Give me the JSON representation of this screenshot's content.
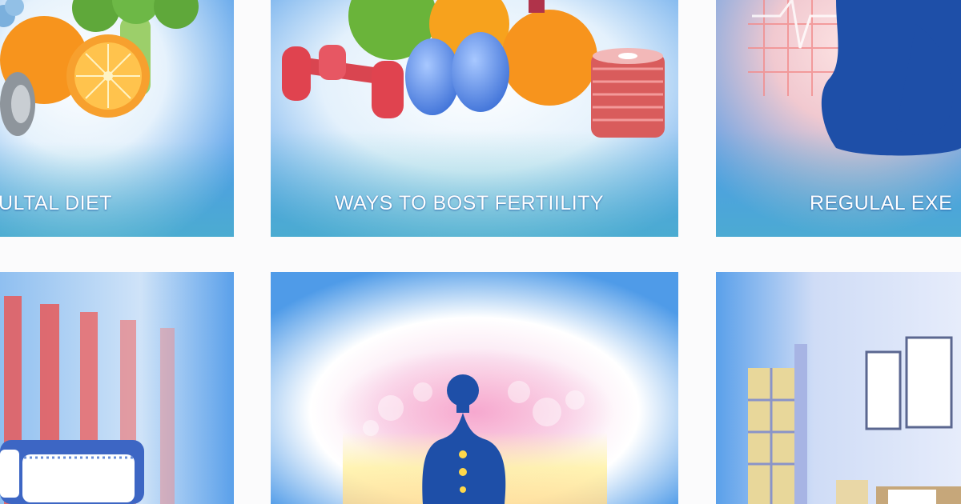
{
  "tiles": [
    {
      "caption": "ULTAL DIET"
    },
    {
      "caption": "WAYS TO BOST FERTIILITY"
    },
    {
      "caption": "REGULAL EXE"
    },
    {
      "caption": ""
    },
    {
      "caption": ""
    },
    {
      "caption": ""
    }
  ],
  "colors": {
    "tile_blue": "#4f9be8",
    "glow": "#ffffff",
    "orange": "#f7941d",
    "dumbbell_red": "#e0434f",
    "figure_blue": "#1e4fa8",
    "stripe_red": "#e85a5a"
  },
  "icons": [
    "fruit-icon",
    "dumbbell-icon",
    "egg-icon",
    "weight-plates-icon",
    "pregnant-silhouette-icon",
    "bed-icon",
    "meditation-silhouette-icon",
    "window-icon",
    "picture-frame-icon"
  ]
}
